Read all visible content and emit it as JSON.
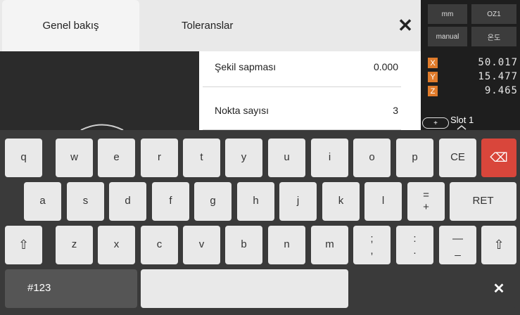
{
  "tabs": {
    "overview": "Genel bakış",
    "tolerances": "Toleranslar"
  },
  "close_symbol": "✕",
  "status": {
    "unit": "mm",
    "zone": "OZ1",
    "mode": "manual",
    "secondary": "온도",
    "axes": [
      {
        "letter": "X",
        "value": "50.017"
      },
      {
        "letter": "Y",
        "value": "15.477"
      },
      {
        "letter": "Z",
        "value": "9.465"
      }
    ],
    "slot_label": "Slot 1",
    "slot_toggle_symbol": "+"
  },
  "list": {
    "rows": [
      {
        "label": "Şekil sapması",
        "value": "0.000"
      },
      {
        "label": "Nokta sayısı",
        "value": "3"
      }
    ]
  },
  "keyboard": {
    "row1": [
      "q",
      "w",
      "e",
      "r",
      "t",
      "y",
      "u",
      "i",
      "o",
      "p",
      "CE"
    ],
    "row2": [
      "a",
      "s",
      "d",
      "f",
      "g",
      "h",
      "j",
      "k",
      "l"
    ],
    "row2_special": {
      "top": "=",
      "bottom": "+"
    },
    "row2_ret": "RET",
    "row3": [
      "z",
      "x",
      "c",
      "v",
      "b",
      "n",
      "m"
    ],
    "row3_punct": [
      {
        "top": ";",
        "bottom": ","
      },
      {
        "top": ":",
        "bottom": "."
      },
      {
        "top": "—",
        "bottom": "_"
      }
    ],
    "numbers_key": "#123",
    "shift_symbol": "⇧",
    "backspace_symbol": "⌫",
    "close_symbol": "✕"
  },
  "colors": {
    "axis_accent": "#e07b2b",
    "backspace_key": "#d9463b"
  }
}
